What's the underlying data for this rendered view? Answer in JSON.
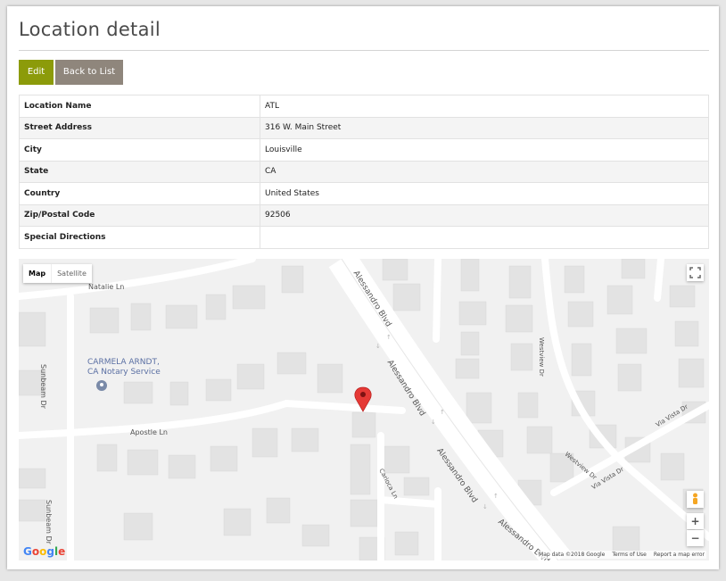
{
  "page": {
    "title": "Location detail"
  },
  "buttons": {
    "edit": "Edit",
    "back": "Back to List"
  },
  "details": [
    {
      "label": "Location Name",
      "value": "ATL"
    },
    {
      "label": "Street Address",
      "value": "316 W. Main Street"
    },
    {
      "label": "City",
      "value": "Louisville"
    },
    {
      "label": "State",
      "value": "CA"
    },
    {
      "label": "Country",
      "value": "United States"
    },
    {
      "label": "Zip/Postal Code",
      "value": "92506"
    },
    {
      "label": "Special Directions",
      "value": ""
    }
  ],
  "map": {
    "type_map": "Map",
    "type_satellite": "Satellite",
    "zoom_in": "+",
    "zoom_out": "−",
    "brand": "Google",
    "attribution": "Map data ©2018 Google",
    "terms": "Terms of Use",
    "report": "Report a map error",
    "poi": {
      "line1": "CARMELA ARNDT,",
      "line2": "CA Notary Service"
    },
    "streets": {
      "natalie": "Natalie Ln",
      "apostle": "Apostle Ln",
      "sunbeam": "Sunbeam Dr",
      "alessandro": "Alessandro Blvd",
      "carioca": "Carioca Ln",
      "westview": "Westview Dr",
      "via_vista": "Via Vista Dr"
    },
    "colors": {
      "road": "#ffffff",
      "block": "#e4e4e4",
      "marker": "#e53935",
      "poi": "#5a6fa3"
    }
  }
}
